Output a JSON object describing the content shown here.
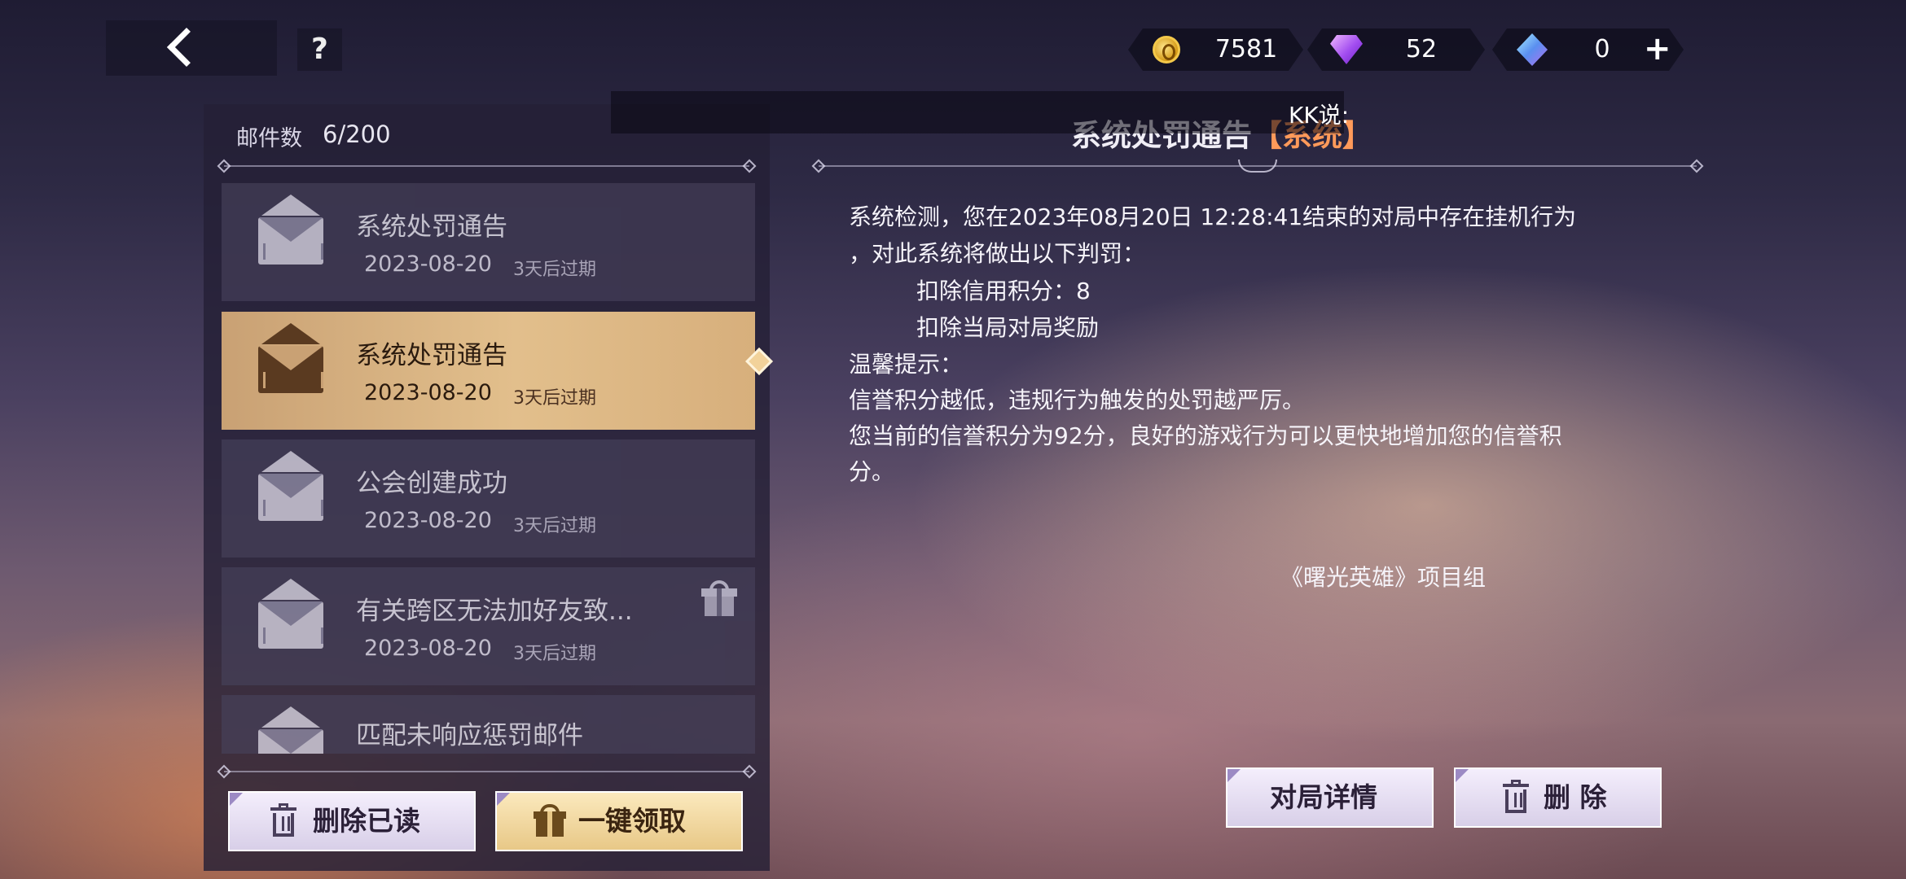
{
  "header": {
    "help_label": "?",
    "currencies": [
      {
        "icon": "gold-coin-icon",
        "value": "7581"
      },
      {
        "icon": "purple-gem-icon",
        "value": "52"
      },
      {
        "icon": "blue-crystal-icon",
        "value": "0"
      }
    ],
    "add_label": "+"
  },
  "mailbox": {
    "count_label": "邮件数",
    "count_value": "6/200",
    "items": [
      {
        "title": "系统处罚通告",
        "date": "2023-08-20",
        "expire": "3天后过期",
        "selected": false,
        "has_gift": false
      },
      {
        "title": "系统处罚通告",
        "date": "2023-08-20",
        "expire": "3天后过期",
        "selected": true,
        "has_gift": false
      },
      {
        "title": "公会创建成功",
        "date": "2023-08-20",
        "expire": "3天后过期",
        "selected": false,
        "has_gift": false
      },
      {
        "title": "有关跨区无法加好友致...",
        "date": "2023-08-20",
        "expire": "3天后过期",
        "selected": false,
        "has_gift": true
      },
      {
        "title": "匹配未响应惩罚邮件",
        "date": "",
        "expire": "",
        "selected": false,
        "has_gift": false
      }
    ],
    "delete_read_label": "删除已读",
    "claim_all_label": "一键领取"
  },
  "overlay": {
    "kk_text": "KK说:"
  },
  "detail": {
    "title": "系统处罚通告",
    "tag": "【系统】",
    "lines": [
      "系统检测，您在2023年08月20日 12:28:41结束的对局中存在挂机行为",
      "，对此系统将做出以下判罚：",
      "扣除信用积分：8",
      "扣除当局对局奖励",
      "温馨提示：",
      "信誉积分越低，违规行为触发的处罚越严厉。",
      "您当前的信誉积分为92分，良好的游戏行为可以更快地增加您的信誉积",
      "分。"
    ],
    "signature": "《曙光英雄》项目组",
    "match_details_label": "对局详情",
    "delete_label": "删 除"
  },
  "colors": {
    "selected_item": "#e2bf8c",
    "tag_orange": "#ff9a5a"
  }
}
